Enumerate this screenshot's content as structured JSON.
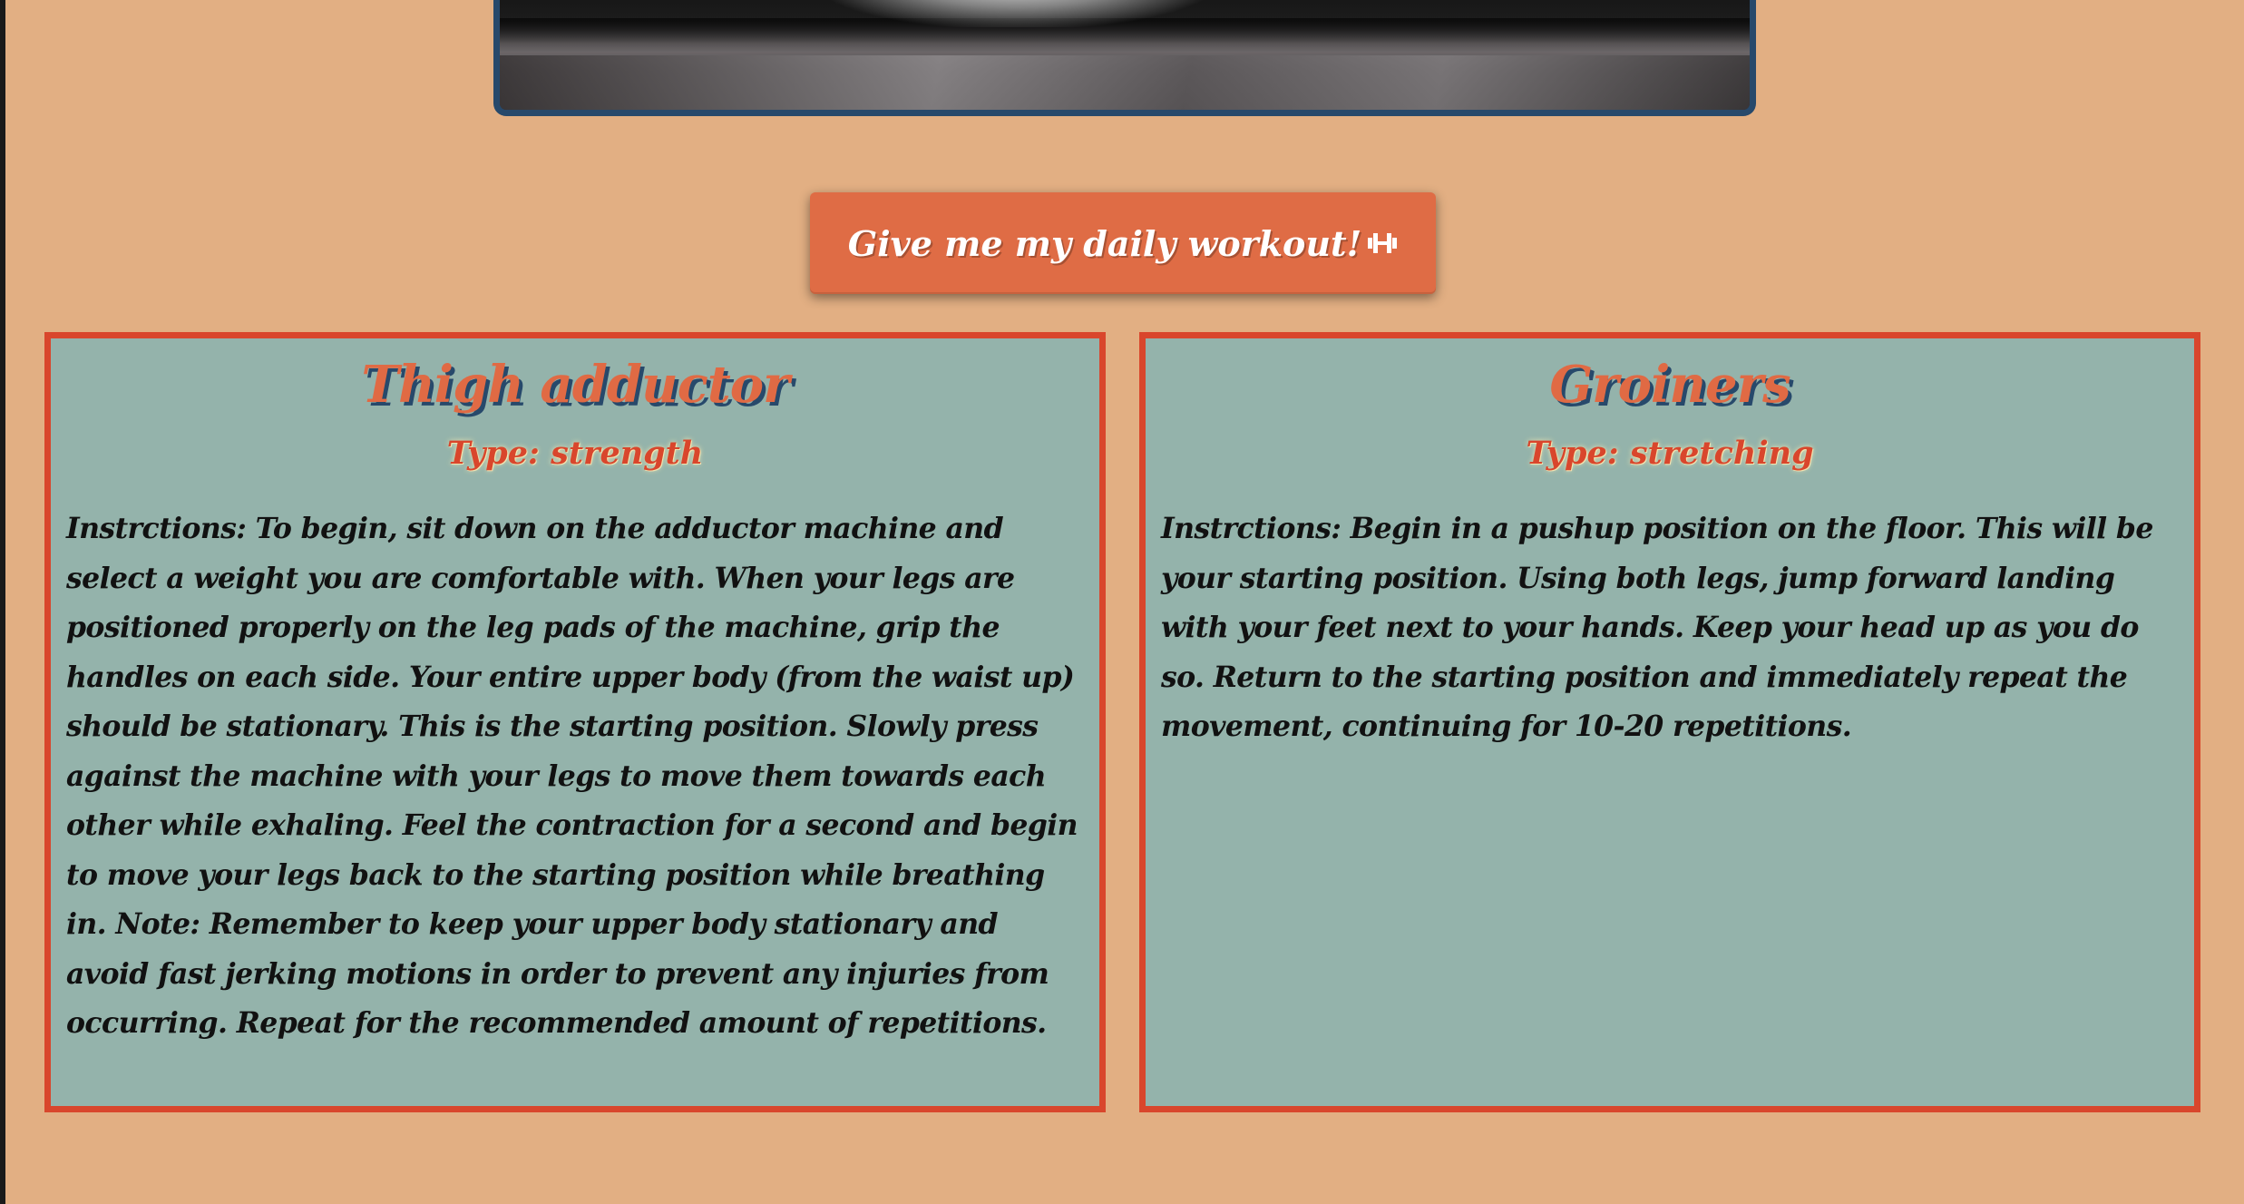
{
  "hero": {
    "image_alt": "workout hero image"
  },
  "action": {
    "label": "Give me my daily workout!",
    "icon": "dumbbell-icon"
  },
  "colors": {
    "page_background": "#e2af83",
    "card_background": "#94b3ab",
    "card_border": "#d9462c",
    "accent": "#df6c45",
    "title_shadow": "#27496b"
  },
  "exercises": [
    {
      "name": "Thigh adductor",
      "type": "Type: strength",
      "instructions": "Instrctions: To begin, sit down on the adductor machine and select a weight you are comfortable with. When your legs are positioned properly on the leg pads of the machine, grip the handles on each side. Your entire upper body (from the waist up) should be stationary. This is the starting position. Slowly press against the machine with your legs to move them towards each other while exhaling. Feel the contraction for a second and begin to move your legs back to the starting position while breathing in. Note: Remember to keep your upper body stationary and avoid fast jerking motions in order to prevent any injuries from occurring. Repeat for the recommended amount of repetitions."
    },
    {
      "name": "Groiners",
      "type": "Type: stretching",
      "instructions": "Instrctions: Begin in a pushup position on the floor. This will be your starting position. Using both legs, jump forward landing with your feet next to your hands. Keep your head up as you do so. Return to the starting position and immediately repeat the movement, continuing for 10-20 repetitions."
    }
  ]
}
